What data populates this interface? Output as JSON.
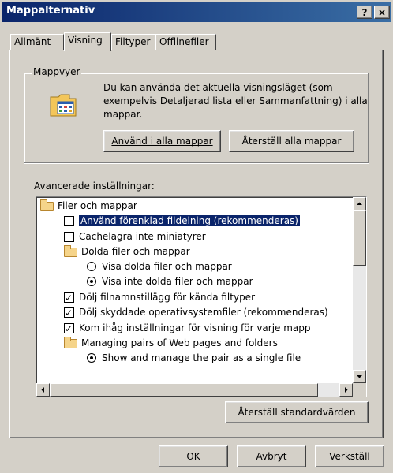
{
  "window": {
    "title": "Mappalternativ"
  },
  "title_buttons": {
    "help": "?",
    "close": "×"
  },
  "tabs": [
    {
      "label": "Allmänt"
    },
    {
      "label": "Visning"
    },
    {
      "label": "Filtyper"
    },
    {
      "label": "Offlinefiler"
    }
  ],
  "folder_views": {
    "legend": "Mappvyer",
    "description_line1": "Du kan använda det aktuella visningsläget (som",
    "description_line2": "exempelvis Detaljerad lista eller Sammanfattning) i alla",
    "description_line3": "mappar.",
    "apply_all_button": "Använd i alla mappar",
    "reset_all_button": "Återställ alla mappar"
  },
  "advanced": {
    "label": "Avancerade inställningar:",
    "items": [
      {
        "type": "folder",
        "label": "Filer och mappar"
      },
      {
        "type": "checkbox",
        "checked": false,
        "selected": true,
        "label": "Använd förenklad fildelning (rekommenderas)"
      },
      {
        "type": "checkbox",
        "checked": false,
        "label": "Cachelagra inte miniatyrer"
      },
      {
        "type": "folder",
        "label": "Dolda filer och mappar"
      },
      {
        "type": "radio",
        "checked": false,
        "label": "Visa dolda filer och mappar"
      },
      {
        "type": "radio",
        "checked": true,
        "label": "Visa inte dolda filer och mappar"
      },
      {
        "type": "checkbox",
        "checked": true,
        "label": "Dölj filnamnstillägg för kända filtyper"
      },
      {
        "type": "checkbox",
        "checked": true,
        "label": "Dölj skyddade operativsystemfiler (rekommenderas)"
      },
      {
        "type": "checkbox",
        "checked": true,
        "label": "Kom ihåg inställningar för visning för varje mapp"
      },
      {
        "type": "folder",
        "label": "Managing pairs of Web pages and folders"
      },
      {
        "type": "radio",
        "checked": true,
        "label": "Show and manage the pair as a single file"
      }
    ],
    "restore_defaults_button": "Återställ standardvärden"
  },
  "footer": {
    "ok": "OK",
    "cancel": "Avbryt",
    "apply": "Verkställ"
  }
}
